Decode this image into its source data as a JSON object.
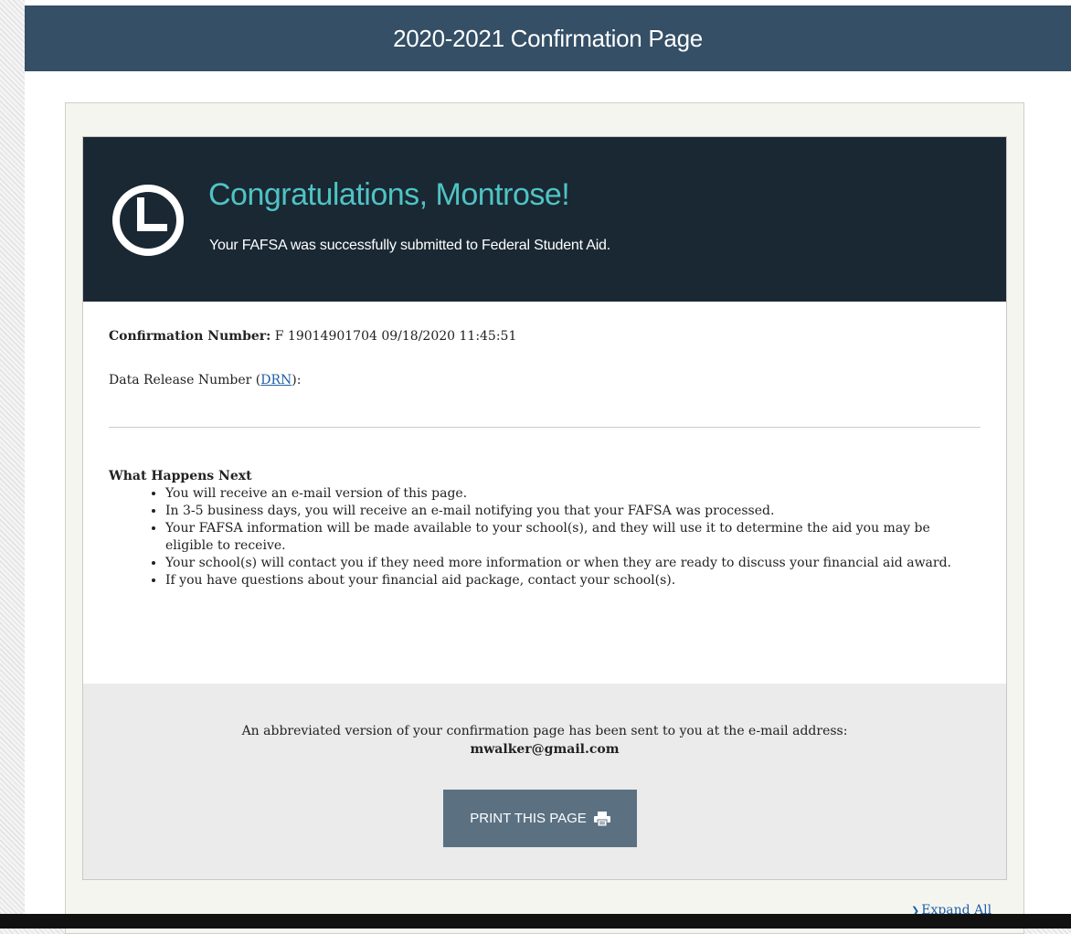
{
  "header": {
    "title": "2020-2021 Confirmation Page"
  },
  "banner": {
    "icon": "clock-icon",
    "title": "Congratulations, Montrose!",
    "subtitle": "Your FAFSA was successfully submitted to Federal Student Aid."
  },
  "confirmation": {
    "label": "Confirmation Number:",
    "value": " F 19014901704 09/18/2020 11:45:51"
  },
  "drn": {
    "label_before": "Data Release Number (",
    "link_text": "DRN",
    "label_after": "):"
  },
  "next_steps": {
    "heading": "What Happens Next",
    "items": [
      "You will receive an e-mail version of this page.",
      "In 3-5 business days, you will receive an e-mail notifying you that your FAFSA was processed.",
      "Your FAFSA information will be made available to your school(s), and they will use it to determine the aid you may be eligible to receive.",
      "Your school(s) will contact you if they need more information or when they are ready to discuss your financial aid award.",
      "If you have questions about your financial aid package, contact your school(s)."
    ]
  },
  "email_notice": {
    "text": "An abbreviated version of your confirmation page has been sent to you at the e-mail address:",
    "address": "mwalker@gmail.com"
  },
  "print_button": {
    "label": "PRINT THIS PAGE",
    "icon": "printer-icon"
  },
  "expand_all": {
    "label": "Expand All",
    "icon": "chevron-right-icon"
  },
  "colors": {
    "header_bg": "#344f66",
    "banner_bg": "#1a2833",
    "accent_teal": "#4fc3c4",
    "button_bg": "#5b7182",
    "link": "#1f5fa8"
  }
}
